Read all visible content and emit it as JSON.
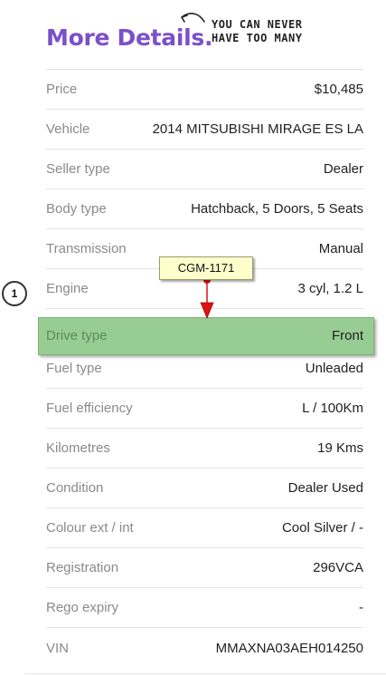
{
  "header": {
    "title": "More Details.",
    "tagline_line1": "YOU CAN NEVER",
    "tagline_line2": "HAVE TOO MANY"
  },
  "details": [
    {
      "label": "Price",
      "value": "$10,485"
    },
    {
      "label": "Vehicle",
      "value": "2014 MITSUBISHI MIRAGE ES LA"
    },
    {
      "label": "Seller type",
      "value": "Dealer"
    },
    {
      "label": "Body type",
      "value": "Hatchback, 5 Doors, 5 Seats"
    },
    {
      "label": "Transmission",
      "value": "Manual"
    },
    {
      "label": "Engine",
      "value": "3 cyl, 1.2 L"
    },
    {
      "label": "Drive type",
      "value": "Front"
    },
    {
      "label": "Fuel type",
      "value": "Unleaded"
    },
    {
      "label": "Fuel efficiency",
      "value": "L / 100Km"
    },
    {
      "label": "Kilometres",
      "value": "19 Kms"
    },
    {
      "label": "Condition",
      "value": "Dealer Used"
    },
    {
      "label": "Colour ext / int",
      "value": "Cool Silver / -"
    },
    {
      "label": "Registration",
      "value": "296VCA"
    },
    {
      "label": "Rego expiry",
      "value": "-"
    },
    {
      "label": "VIN",
      "value": "MMAXNA03AEH014250"
    }
  ],
  "annotation": {
    "callout_text": "CGM-1171",
    "marker_number": "1",
    "highlight_color": "#97cc92",
    "arrow_color": "#dd1111"
  },
  "colors": {
    "title": "#7b4fc9",
    "label": "#8a8a8a",
    "value": "#222222"
  }
}
